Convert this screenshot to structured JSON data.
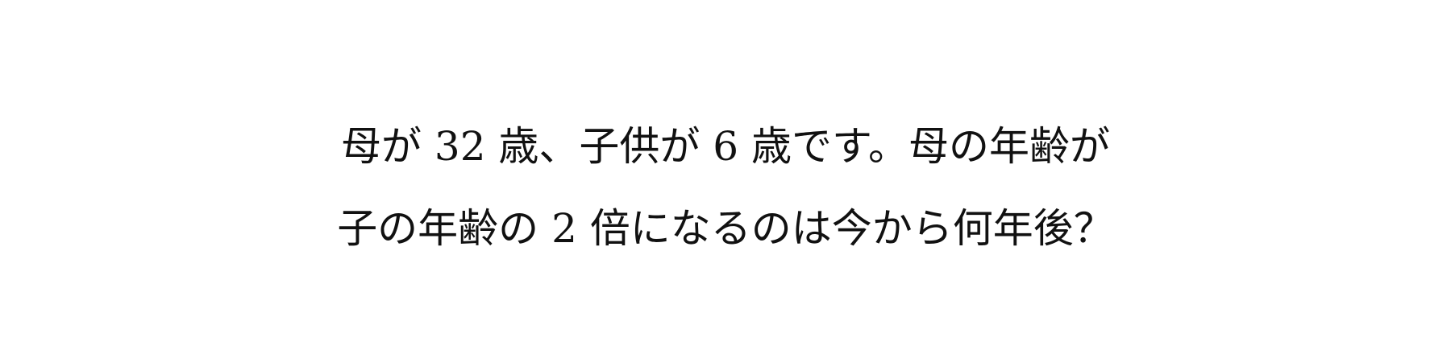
{
  "problem": {
    "lines": [
      "母が 32 歳、子供が 6 歳です。母の年齢が",
      "子の年齢の 2 倍になるのは今から何年後？"
    ]
  }
}
